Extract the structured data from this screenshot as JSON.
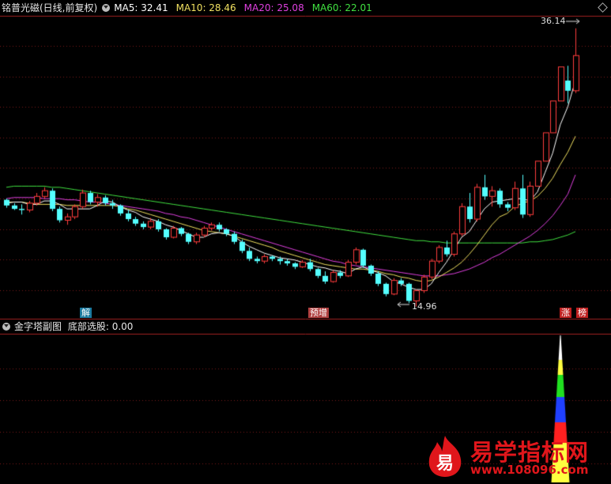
{
  "header": {
    "title": "铭普光磁(日线,前复权)",
    "ma": [
      {
        "label": "MA5: 32.41",
        "color": "#ffffff"
      },
      {
        "label": "MA10: 28.46",
        "color": "#f0e060"
      },
      {
        "label": "MA20: 25.08",
        "color": "#e040e0"
      },
      {
        "label": "MA60: 22.01",
        "color": "#40e040"
      }
    ]
  },
  "price_labels": {
    "high": "36.14",
    "low": "14.96"
  },
  "markers": [
    {
      "text": "解",
      "bg": "#1a7aa0"
    },
    {
      "text": "预增",
      "bg": "#b04040"
    },
    {
      "text": "涨",
      "bg": "#c02020"
    },
    {
      "text": "榜",
      "bg": "#c02020"
    }
  ],
  "sub_header": {
    "title": "金字塔副图",
    "indicator": "底部选股: 0.00"
  },
  "watermark": {
    "name": "易学指标网",
    "url": "www.108096.com",
    "icon_char": "易"
  },
  "colors": {
    "up": "#ff3c3c",
    "down": "#54ffff",
    "grid": "#7a1a1a",
    "ma5": "#ffffff",
    "ma10": "#f0e060",
    "ma20": "#e040e0",
    "ma60": "#40e040"
  },
  "chart_data": {
    "type": "candlestick",
    "price_range": [
      13,
      38
    ],
    "candles": [
      [
        21.8,
        21.9,
        21.1,
        21.3
      ],
      [
        21.3,
        21.5,
        20.9,
        21.0
      ],
      [
        21.0,
        21.4,
        20.5,
        20.9
      ],
      [
        20.9,
        21.7,
        20.7,
        21.5
      ],
      [
        21.5,
        22.4,
        21.3,
        22.1
      ],
      [
        22.1,
        22.9,
        21.9,
        22.6
      ],
      [
        22.6,
        22.8,
        20.8,
        21.0
      ],
      [
        21.0,
        21.2,
        19.8,
        20.0
      ],
      [
        20.0,
        20.6,
        19.6,
        20.3
      ],
      [
        20.3,
        21.4,
        20.1,
        21.2
      ],
      [
        21.2,
        22.7,
        21.0,
        22.4
      ],
      [
        22.4,
        22.6,
        21.4,
        21.6
      ],
      [
        21.6,
        22.3,
        21.2,
        22.0
      ],
      [
        22.0,
        22.2,
        21.3,
        21.5
      ],
      [
        21.5,
        21.8,
        21.0,
        21.3
      ],
      [
        21.3,
        21.4,
        20.4,
        20.6
      ],
      [
        20.6,
        20.9,
        19.9,
        20.1
      ],
      [
        20.1,
        20.3,
        19.5,
        19.7
      ],
      [
        19.7,
        19.9,
        19.2,
        19.4
      ],
      [
        19.4,
        20.2,
        19.2,
        19.9
      ],
      [
        19.9,
        20.1,
        19.0,
        19.2
      ],
      [
        19.2,
        19.3,
        18.3,
        18.5
      ],
      [
        18.5,
        19.5,
        18.4,
        19.3
      ],
      [
        19.3,
        19.4,
        18.6,
        18.8
      ],
      [
        18.8,
        18.9,
        17.9,
        18.1
      ],
      [
        18.1,
        18.9,
        17.9,
        18.7
      ],
      [
        18.7,
        19.5,
        18.5,
        19.3
      ],
      [
        19.3,
        19.8,
        19.1,
        19.6
      ],
      [
        19.6,
        19.8,
        19.0,
        19.2
      ],
      [
        19.2,
        19.3,
        18.6,
        18.8
      ],
      [
        18.8,
        19.0,
        17.9,
        18.1
      ],
      [
        18.1,
        18.3,
        17.1,
        17.3
      ],
      [
        17.3,
        17.6,
        16.4,
        16.6
      ],
      [
        16.6,
        16.8,
        16.2,
        16.4
      ],
      [
        16.4,
        17.0,
        16.2,
        16.8
      ],
      [
        16.8,
        16.9,
        16.4,
        16.6
      ],
      [
        16.6,
        16.8,
        16.1,
        16.4
      ],
      [
        16.4,
        16.6,
        16.0,
        16.2
      ],
      [
        16.2,
        16.3,
        15.7,
        15.9
      ],
      [
        15.9,
        16.5,
        15.8,
        16.3
      ],
      [
        16.3,
        16.6,
        15.5,
        15.7
      ],
      [
        15.7,
        15.8,
        14.9,
        15.1
      ],
      [
        15.1,
        15.5,
        14.4,
        14.6
      ],
      [
        14.6,
        15.6,
        14.5,
        15.4
      ],
      [
        15.4,
        15.6,
        14.9,
        15.1
      ],
      [
        15.1,
        16.5,
        15.0,
        16.3
      ],
      [
        16.3,
        17.6,
        16.1,
        17.4
      ],
      [
        17.4,
        17.5,
        15.8,
        16.0
      ],
      [
        16.0,
        16.1,
        15.1,
        15.3
      ],
      [
        15.3,
        15.5,
        14.2,
        14.4
      ],
      [
        14.4,
        14.5,
        13.3,
        13.5
      ],
      [
        13.5,
        14.9,
        13.4,
        14.7
      ],
      [
        14.7,
        14.9,
        14.2,
        14.4
      ],
      [
        14.4,
        14.5,
        12.7,
        12.9
      ],
      [
        12.9,
        13.9,
        12.4,
        13.8
      ],
      [
        13.8,
        15.2,
        13.6,
        15.0
      ],
      [
        15.0,
        16.6,
        14.8,
        16.4
      ],
      [
        16.4,
        17.8,
        16.2,
        17.6
      ],
      [
        17.6,
        18.2,
        16.8,
        17.0
      ],
      [
        17.0,
        19.0,
        16.8,
        18.8
      ],
      [
        18.8,
        21.5,
        18.6,
        21.2
      ],
      [
        21.2,
        22.4,
        19.8,
        20.1
      ],
      [
        20.1,
        23.2,
        19.9,
        22.9
      ],
      [
        22.9,
        24.0,
        21.8,
        22.1
      ],
      [
        22.1,
        23.0,
        21.2,
        22.6
      ],
      [
        22.6,
        22.8,
        21.1,
        21.4
      ],
      [
        21.4,
        21.6,
        20.8,
        21.1
      ],
      [
        21.1,
        23.4,
        20.9,
        22.8
      ],
      [
        22.8,
        24.0,
        20.2,
        20.5
      ],
      [
        20.5,
        23.4,
        20.3,
        23.0
      ],
      [
        23.0,
        25.2,
        23.0,
        25.2
      ],
      [
        25.2,
        27.7,
        25.2,
        27.7
      ],
      [
        27.7,
        30.5,
        27.7,
        30.5
      ],
      [
        30.5,
        33.5,
        30.5,
        33.5
      ],
      [
        32.3,
        33.6,
        30.3,
        31.4
      ],
      [
        31.4,
        36.9,
        31.2,
        34.5
      ]
    ],
    "ma5": [
      21.5,
      21.6,
      21.6,
      21.4,
      21.4,
      21.7,
      21.7,
      21.4,
      21.0,
      21.0,
      21.0,
      21.0,
      21.3,
      21.7,
      21.6,
      21.2,
      20.9,
      20.7,
      20.3,
      20.1,
      19.9,
      19.6,
      19.4,
      19.1,
      18.8,
      18.5,
      18.5,
      18.8,
      18.9,
      18.8,
      18.6,
      18.1,
      17.7,
      17.4,
      17.1,
      16.9,
      16.7,
      16.6,
      16.5,
      16.3,
      16.1,
      15.9,
      15.8,
      15.6,
      15.5,
      15.3,
      15.7,
      15.9,
      15.6,
      15.4,
      15.1,
      14.6,
      14.4,
      14.1,
      13.9,
      13.9,
      14.4,
      15.4,
      16.3,
      17.4,
      18.5,
      19.0,
      20.0,
      21.0,
      21.6,
      21.7,
      21.8,
      21.9,
      21.9,
      21.7,
      22.5,
      24.2,
      25.9,
      28.4,
      30.0,
      32.3
    ],
    "ma10": [
      21.6,
      21.6,
      21.6,
      21.5,
      21.4,
      21.4,
      21.4,
      21.4,
      21.3,
      21.3,
      21.3,
      21.3,
      21.3,
      21.3,
      21.3,
      21.2,
      21.0,
      20.9,
      20.7,
      20.5,
      20.3,
      20.1,
      19.9,
      19.7,
      19.5,
      19.3,
      19.1,
      19.0,
      18.9,
      18.8,
      18.6,
      18.4,
      18.2,
      18.0,
      17.8,
      17.6,
      17.3,
      17.1,
      16.9,
      16.7,
      16.5,
      16.3,
      16.1,
      16.0,
      15.9,
      15.8,
      15.7,
      15.7,
      15.6,
      15.5,
      15.3,
      15.2,
      15.0,
      14.9,
      14.7,
      14.6,
      14.7,
      15.0,
      15.4,
      15.8,
      16.3,
      17.0,
      17.8,
      18.7,
      19.6,
      20.3,
      20.6,
      21.2,
      21.5,
      21.7,
      22.1,
      22.8,
      23.7,
      24.9,
      26.0,
      27.4
    ],
    "ma20": [
      21.9,
      22.0,
      22.0,
      22.0,
      22.0,
      21.9,
      21.9,
      21.9,
      21.8,
      21.8,
      21.7,
      21.6,
      21.6,
      21.5,
      21.4,
      21.3,
      21.2,
      21.1,
      21.0,
      20.9,
      20.8,
      20.6,
      20.5,
      20.3,
      20.2,
      20.0,
      19.8,
      19.6,
      19.4,
      19.2,
      19.0,
      18.8,
      18.6,
      18.4,
      18.2,
      18.0,
      17.8,
      17.6,
      17.4,
      17.2,
      17.0,
      16.8,
      16.6,
      16.4,
      16.3,
      16.1,
      16.0,
      15.9,
      15.8,
      15.7,
      15.6,
      15.5,
      15.4,
      15.3,
      15.2,
      15.1,
      15.1,
      15.1,
      15.2,
      15.3,
      15.5,
      15.7,
      16.0,
      16.3,
      16.7,
      17.0,
      17.4,
      17.8,
      18.2,
      18.6,
      19.1,
      19.7,
      20.4,
      21.3,
      22.3,
      24.0
    ],
    "ma60": [
      22.9,
      23.0,
      23.0,
      23.0,
      23.0,
      23.0,
      22.9,
      22.9,
      22.8,
      22.7,
      22.6,
      22.5,
      22.4,
      22.3,
      22.2,
      22.1,
      22.0,
      21.9,
      21.8,
      21.7,
      21.6,
      21.5,
      21.4,
      21.3,
      21.2,
      21.1,
      21.0,
      20.9,
      20.8,
      20.7,
      20.6,
      20.5,
      20.4,
      20.3,
      20.2,
      20.1,
      20.0,
      19.9,
      19.8,
      19.7,
      19.6,
      19.5,
      19.4,
      19.3,
      19.2,
      19.1,
      19.0,
      18.9,
      18.8,
      18.7,
      18.6,
      18.5,
      18.4,
      18.3,
      18.2,
      18.2,
      18.1,
      18.1,
      18.0,
      18.0,
      18.0,
      18.0,
      18.0,
      18.0,
      18.0,
      18.0,
      18.0,
      18.0,
      18.0,
      18.1,
      18.1,
      18.2,
      18.3,
      18.5,
      18.7,
      19.0
    ],
    "pyramid": {
      "index": 73,
      "bands": [
        "#ffff40",
        "#ff2020",
        "#2040ff",
        "#20e020",
        "#ffff40",
        "#ffffff"
      ]
    }
  }
}
